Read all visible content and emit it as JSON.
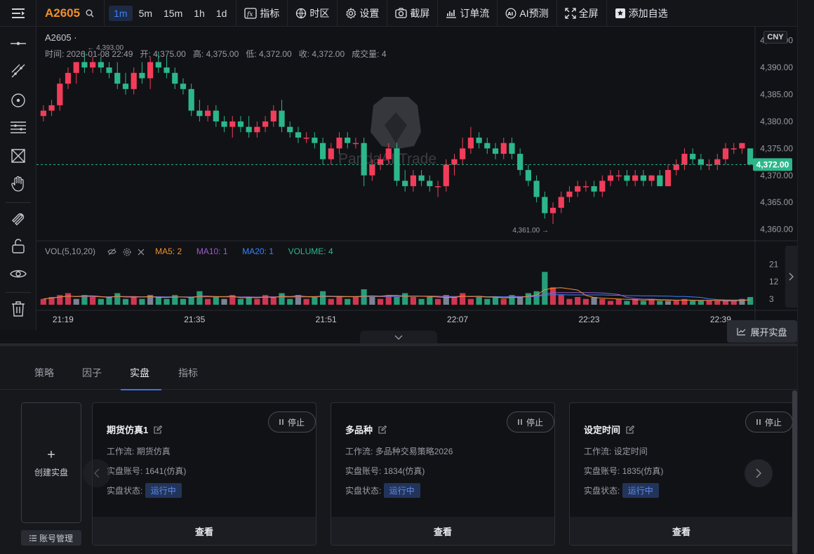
{
  "topbar": {
    "symbol": "A2605",
    "intervals": [
      "1m",
      "5m",
      "15m",
      "1h",
      "1d"
    ],
    "active_interval": "1m",
    "tools": [
      {
        "label": "指标",
        "icon": "fx-icon"
      },
      {
        "label": "时区",
        "icon": "globe-clock-icon"
      },
      {
        "label": "设置",
        "icon": "gear-icon"
      },
      {
        "label": "截屏",
        "icon": "camera-icon"
      },
      {
        "label": "订单流",
        "icon": "order-flow-icon"
      },
      {
        "label": "AI预测",
        "icon": "ai-icon"
      },
      {
        "label": "全屏",
        "icon": "fullscreen-icon"
      },
      {
        "label": "添加自选",
        "icon": "star-add-icon"
      }
    ]
  },
  "chart_header": {
    "title": "A2605 ·",
    "currency": "CNY",
    "info_time_label": "时间:",
    "info_time": "2026-01-08 22:49",
    "info_open_label": "开:",
    "info_open": "4,375.00",
    "info_high_label": "高:",
    "info_high": "4,375.00",
    "info_low_label": "低:",
    "info_low": "4,372.00",
    "info_close_label": "收:",
    "info_close": "4,372.00",
    "info_volume_label": "成交量:",
    "info_volume": "4"
  },
  "volume_legend": {
    "label": "VOL(5,10,20)",
    "ma5": "MA5: 2",
    "ma10": "MA10: 1",
    "ma20": "MA20: 1",
    "volume": "VOLUME: 4"
  },
  "colors": {
    "up": "#f23d5a",
    "down": "#2cb78b",
    "ma5": "#f0902a",
    "ma10": "#9a5cc8",
    "ma20": "#3b82f6",
    "accent": "#3b6ff2",
    "symbol": "#f0902a"
  },
  "watermark": "PandaAI Trade",
  "chart_data": {
    "type": "candlestick",
    "y_ticks": [
      "4,395.00",
      "4,390.00",
      "4,385.00",
      "4,380.00",
      "4,375.00",
      "4,370.00",
      "4,365.00",
      "4,360.00"
    ],
    "ylim": [
      4358,
      4396
    ],
    "x_ticks": [
      "21:19",
      "21:35",
      "21:51",
      "22:07",
      "22:23",
      "22:39"
    ],
    "last_price": "4,372.00",
    "last_price_value": 4372,
    "high_marker": "4,393.00",
    "low_marker": "4,361.00",
    "vol_ticks": [
      "21",
      "12",
      "3"
    ],
    "vol_ylim": [
      0,
      24
    ],
    "candles": [
      [
        4381,
        4383,
        4380,
        4382,
        3
      ],
      [
        4382,
        4384,
        4381,
        4383,
        4
      ],
      [
        4383,
        4388,
        4382,
        4387,
        5
      ],
      [
        4387,
        4390,
        4386,
        4389,
        6
      ],
      [
        4389,
        4391,
        4387,
        4391,
        3
      ],
      [
        4391,
        4393,
        4389,
        4390,
        5
      ],
      [
        4390,
        4392,
        4389,
        4391,
        4
      ],
      [
        4391,
        4392,
        4389,
        4390,
        3
      ],
      [
        4390,
        4391,
        4388,
        4389,
        4
      ],
      [
        4389,
        4391,
        4386,
        4387,
        6
      ],
      [
        4387,
        4389,
        4385,
        4386,
        3
      ],
      [
        4386,
        4390,
        4385,
        4389,
        4
      ],
      [
        4389,
        4391,
        4387,
        4388,
        3
      ],
      [
        4388,
        4392,
        4386,
        4391,
        5
      ],
      [
        4391,
        4393,
        4389,
        4390,
        4
      ],
      [
        4390,
        4392,
        4388,
        4389,
        3
      ],
      [
        4389,
        4390,
        4386,
        4387,
        5
      ],
      [
        4387,
        4388,
        4385,
        4386,
        3
      ],
      [
        4386,
        4387,
        4381,
        4382,
        4
      ],
      [
        4382,
        4384,
        4380,
        4381,
        7
      ],
      [
        4381,
        4383,
        4380,
        4382,
        3
      ],
      [
        4382,
        4383,
        4379,
        4380,
        4
      ],
      [
        4380,
        4381,
        4378,
        4379,
        3
      ],
      [
        4379,
        4381,
        4377,
        4380,
        5
      ],
      [
        4380,
        4381,
        4378,
        4379,
        3
      ],
      [
        4379,
        4381,
        4377,
        4378,
        4
      ],
      [
        4378,
        4380,
        4377,
        4379,
        3
      ],
      [
        4379,
        4381,
        4378,
        4380,
        5
      ],
      [
        4380,
        4383,
        4379,
        4382,
        4
      ],
      [
        4382,
        4384,
        4378,
        4379,
        6
      ],
      [
        4379,
        4380,
        4377,
        4378,
        3
      ],
      [
        4378,
        4379,
        4376,
        4377,
        5
      ],
      [
        4377,
        4378,
        4376,
        4377,
        3
      ],
      [
        4377,
        4378,
        4375,
        4376,
        4
      ],
      [
        4376,
        4377,
        4372,
        4373,
        7
      ],
      [
        4373,
        4376,
        4372,
        4375,
        3
      ],
      [
        4375,
        4378,
        4374,
        4377,
        4
      ],
      [
        4377,
        4378,
        4375,
        4376,
        3
      ],
      [
        4376,
        4377,
        4375,
        4376,
        4
      ],
      [
        4376,
        4377,
        4368,
        4370,
        8
      ],
      [
        4370,
        4373,
        4369,
        4372,
        4
      ],
      [
        4372,
        4374,
        4371,
        4373,
        3
      ],
      [
        4373,
        4376,
        4372,
        4375,
        5
      ],
      [
        4375,
        4376,
        4368,
        4369,
        4
      ],
      [
        4369,
        4371,
        4367,
        4368,
        6
      ],
      [
        4368,
        4371,
        4367,
        4370,
        4
      ],
      [
        4370,
        4371,
        4368,
        4369,
        3
      ],
      [
        4369,
        4370,
        4367,
        4368,
        4
      ],
      [
        4368,
        4369,
        4366,
        4368,
        3
      ],
      [
        4368,
        4373,
        4367,
        4372,
        5
      ],
      [
        4372,
        4374,
        4370,
        4373,
        4
      ],
      [
        4373,
        4377,
        4372,
        4375,
        6
      ],
      [
        4375,
        4379,
        4374,
        4377,
        3
      ],
      [
        4377,
        4378,
        4375,
        4376,
        4
      ],
      [
        4376,
        4377,
        4374,
        4375,
        3
      ],
      [
        4375,
        4376,
        4373,
        4374,
        4
      ],
      [
        4374,
        4377,
        4373,
        4376,
        3
      ],
      [
        4376,
        4377,
        4373,
        4374,
        5
      ],
      [
        4374,
        4375,
        4370,
        4371,
        4
      ],
      [
        4371,
        4372,
        4368,
        4369,
        6
      ],
      [
        4369,
        4370,
        4365,
        4366,
        7
      ],
      [
        4366,
        4367,
        4362,
        4363,
        17
      ],
      [
        4363,
        4365,
        4361,
        4364,
        9
      ],
      [
        4364,
        4367,
        4363,
        4366,
        5
      ],
      [
        4366,
        4368,
        4365,
        4367,
        3
      ],
      [
        4367,
        4369,
        4366,
        4368,
        4
      ],
      [
        4368,
        4369,
        4367,
        4368,
        3
      ],
      [
        4368,
        4369,
        4366,
        4367,
        4
      ],
      [
        4367,
        4370,
        4366,
        4369,
        3
      ],
      [
        4369,
        4371,
        4368,
        4370,
        2
      ],
      [
        4370,
        4371,
        4369,
        4370,
        3
      ],
      [
        4370,
        4371,
        4368,
        4369,
        2
      ],
      [
        4369,
        4371,
        4368,
        4370,
        3
      ],
      [
        4370,
        4371,
        4368,
        4369,
        2
      ],
      [
        4369,
        4370,
        4368,
        4370,
        3
      ],
      [
        4370,
        4371,
        4368,
        4368,
        2
      ],
      [
        4368,
        4372,
        4368,
        4371,
        2
      ],
      [
        4371,
        4373,
        4370,
        4372,
        2
      ],
      [
        4372,
        4375,
        4371,
        4374,
        3
      ],
      [
        4374,
        4375,
        4372,
        4373,
        2
      ],
      [
        4373,
        4374,
        4371,
        4372,
        2
      ],
      [
        4372,
        4373,
        4371,
        4372,
        2
      ],
      [
        4372,
        4374,
        4371,
        4373,
        2
      ],
      [
        4373,
        4376,
        4372,
        4375,
        2
      ],
      [
        4375,
        4376,
        4374,
        4375,
        2
      ],
      [
        4375,
        4376,
        4374,
        4376,
        3
      ],
      [
        4375,
        4375,
        4372,
        4372,
        4
      ]
    ]
  },
  "panel": {
    "tabs": [
      "策略",
      "因子",
      "实盘",
      "指标"
    ],
    "active_tab": "实盘",
    "create_label": "创建实盘",
    "create_plus": "+",
    "account_button": "账号管理",
    "cards": [
      {
        "title": "期货仿真1",
        "workflow_label": "工作流:",
        "workflow": "期货仿真",
        "account_label": "实盘账号:",
        "account": "1641(仿真)",
        "status_label": "实盘状态:",
        "status": "运行中",
        "stop_label": "停止",
        "view_label": "查看"
      },
      {
        "title": "多品种",
        "workflow_label": "工作流:",
        "workflow": "多品种交易策略2026",
        "account_label": "实盘账号:",
        "account": "1834(仿真)",
        "status_label": "实盘状态:",
        "status": "运行中",
        "stop_label": "停止",
        "view_label": "查看"
      },
      {
        "title": "设定时间",
        "workflow_label": "工作流:",
        "workflow": "设定时间",
        "account_label": "实盘账号:",
        "account": "1835(仿真)",
        "status_label": "实盘状态:",
        "status": "运行中",
        "stop_label": "停止",
        "view_label": "查看"
      }
    ],
    "expand_label": "展开实盘"
  }
}
